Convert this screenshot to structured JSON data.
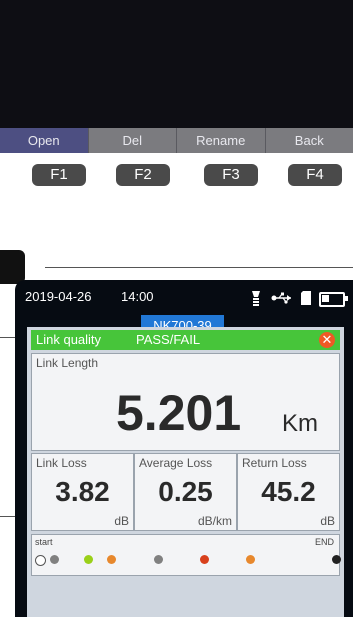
{
  "function_bar": {
    "tabs": [
      "Open",
      "Del",
      "Rename",
      "Back"
    ],
    "keys": [
      "F1",
      "F2",
      "F3",
      "F4"
    ]
  },
  "status": {
    "date": "2019-04-26",
    "time": "14:00",
    "battery_level": 0.35
  },
  "device_name": "NK700-39",
  "quality": {
    "label": "Link quality",
    "status": "PASS/FAIL",
    "close_glyph": "✕"
  },
  "link_length": {
    "title": "Link Length",
    "value": "5.201",
    "unit": "Km"
  },
  "metrics": [
    {
      "title": "Link Loss",
      "value": "3.82",
      "unit": "dB"
    },
    {
      "title": "Average Loss",
      "value": "0.25",
      "unit": "dB/km"
    },
    {
      "title": "Return Loss",
      "value": "45.2",
      "unit": "dB"
    }
  ],
  "event_bar": {
    "start_label": "start",
    "end_label": "END",
    "dot_colors": [
      "#808080",
      "#9ad019",
      "#e7882d",
      "#808080",
      "#d8401c",
      "#e7882d",
      "#222222"
    ]
  },
  "colors": {
    "active_tab": "#4d4f82",
    "quality_bar": "#47c53a",
    "device_name_bg": "#2178d6",
    "close_button": "#ee5a24"
  }
}
